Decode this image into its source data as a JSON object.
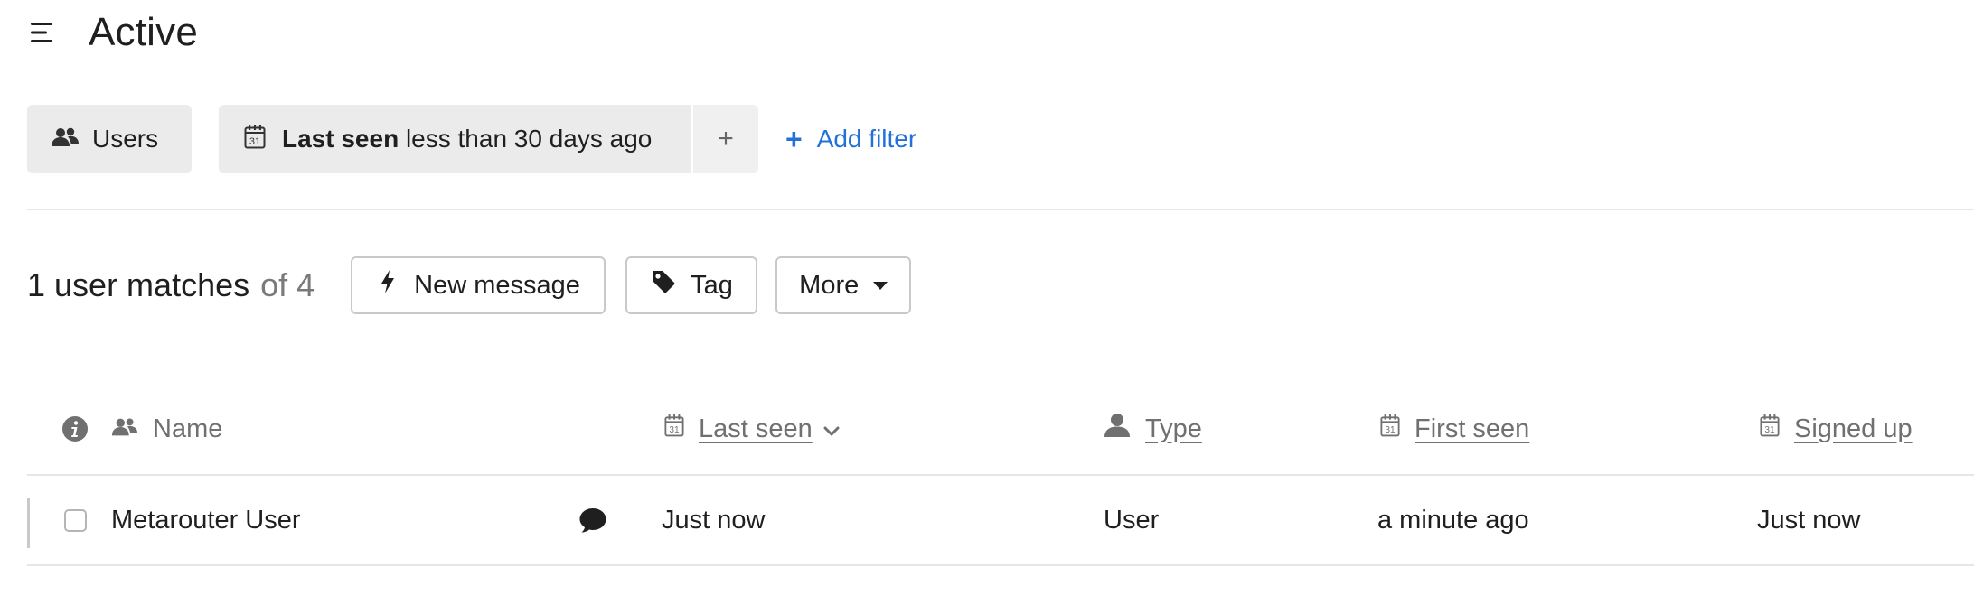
{
  "header": {
    "title": "Active",
    "menu_icon": "hamburger-menu-icon"
  },
  "filters": {
    "users_chip": {
      "icon": "users-icon",
      "label": "Users"
    },
    "last_seen_chip": {
      "icon": "calendar-icon",
      "field": "Last seen",
      "condition": "less than 30 days ago"
    },
    "add_to_group": "+",
    "add_filter": {
      "icon": "plus-icon",
      "label": "Add filter"
    }
  },
  "summary": {
    "count_text": "1 user matches",
    "of_text": "of 4"
  },
  "actions": {
    "new_message": {
      "icon": "lightning-icon",
      "label": "New message"
    },
    "tag": {
      "icon": "tag-icon",
      "label": "Tag"
    },
    "more": {
      "icon": "caret-down-icon",
      "label": "More"
    }
  },
  "table": {
    "columns": [
      {
        "key": "name",
        "label": "Name",
        "icon": "users-icon",
        "sortable": false
      },
      {
        "key": "last_seen",
        "label": "Last seen",
        "icon": "calendar-icon",
        "sortable": true,
        "sorted": "desc"
      },
      {
        "key": "type",
        "label": "Type",
        "icon": "person-icon",
        "sortable": true
      },
      {
        "key": "first_seen",
        "label": "First seen",
        "icon": "calendar-icon",
        "sortable": true
      },
      {
        "key": "signed_up",
        "label": "Signed up",
        "icon": "calendar-icon",
        "sortable": true
      }
    ],
    "rows": [
      {
        "name": "Metarouter User",
        "chat_icon": "chat-bubble-icon",
        "last_seen": "Just now",
        "type": "User",
        "first_seen": "a minute ago",
        "signed_up": "Just now"
      }
    ]
  },
  "colors": {
    "accent": "#2271d8",
    "chip_bg": "#ebebeb",
    "muted_text": "#707070",
    "border": "#c9c9c9"
  }
}
